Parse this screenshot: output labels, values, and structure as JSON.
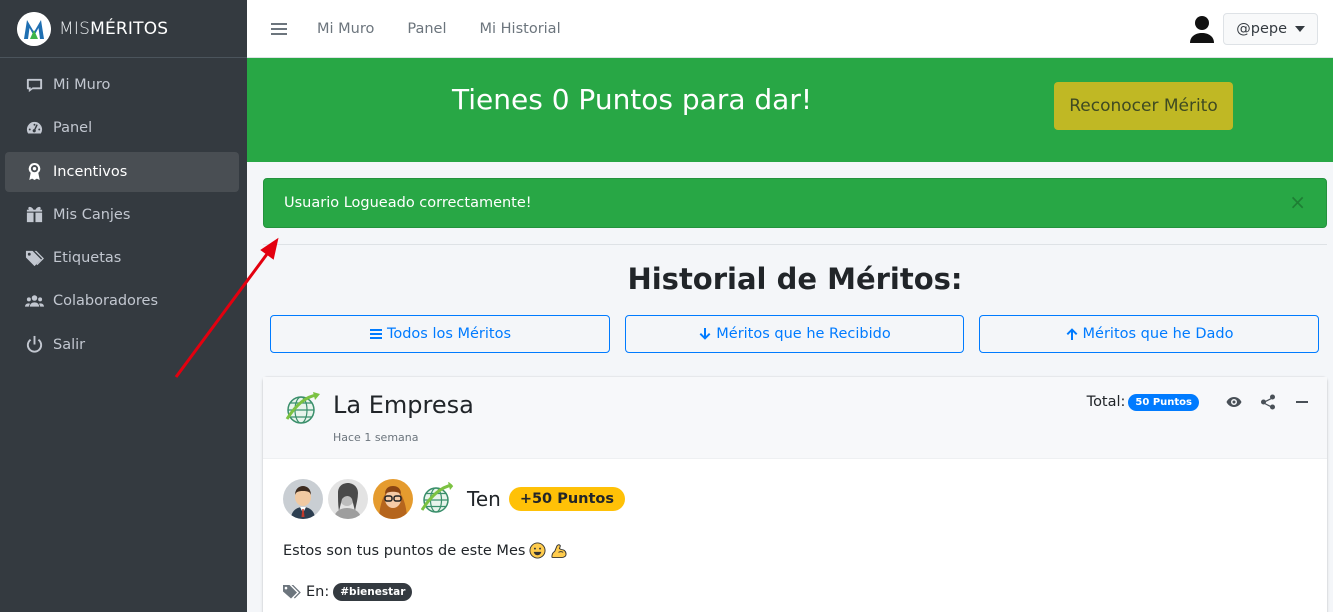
{
  "brand": {
    "name_prefix": "MIS",
    "name_suffix": "MÉRITOS"
  },
  "sidebar": {
    "items": [
      {
        "label": "Mi Muro",
        "icon": "comment-icon"
      },
      {
        "label": "Panel",
        "icon": "dashboard-icon"
      },
      {
        "label": "Incentivos",
        "icon": "award-icon",
        "active": true
      },
      {
        "label": "Mis Canjes",
        "icon": "gifts-icon"
      },
      {
        "label": "Etiquetas",
        "icon": "tags-icon"
      },
      {
        "label": "Colaboradores",
        "icon": "users-icon"
      },
      {
        "label": "Salir",
        "icon": "power-icon"
      }
    ]
  },
  "topbar": {
    "links": [
      "Mi Muro",
      "Panel",
      "Mi Historial"
    ],
    "user": "@pepe"
  },
  "hero": {
    "title": "Tienes 0 Puntos para dar!",
    "button": "Reconocer Mérito"
  },
  "alert": {
    "message": "Usuario Logueado correctamente!",
    "close": "×"
  },
  "history": {
    "title": "Historial de Méritos:",
    "filters": [
      "Todos los Méritos",
      "Méritos que he Recibido",
      "Méritos que he Dado"
    ]
  },
  "card": {
    "organization": "La Empresa",
    "time": "Hace 1 semana",
    "total_label": "Total:",
    "total_badge": "50 Puntos",
    "ten_text": "Ten",
    "plus_badge": "+50 Puntos",
    "message": "Estos son tus puntos de este Mes",
    "tags_label": "En:",
    "tag": "#bienestar"
  },
  "colors": {
    "sidebar_bg": "#343a40",
    "hero_bg": "#28a745",
    "primary": "#007bff",
    "warning": "#ffc107",
    "accent_button": "#c0b824"
  }
}
